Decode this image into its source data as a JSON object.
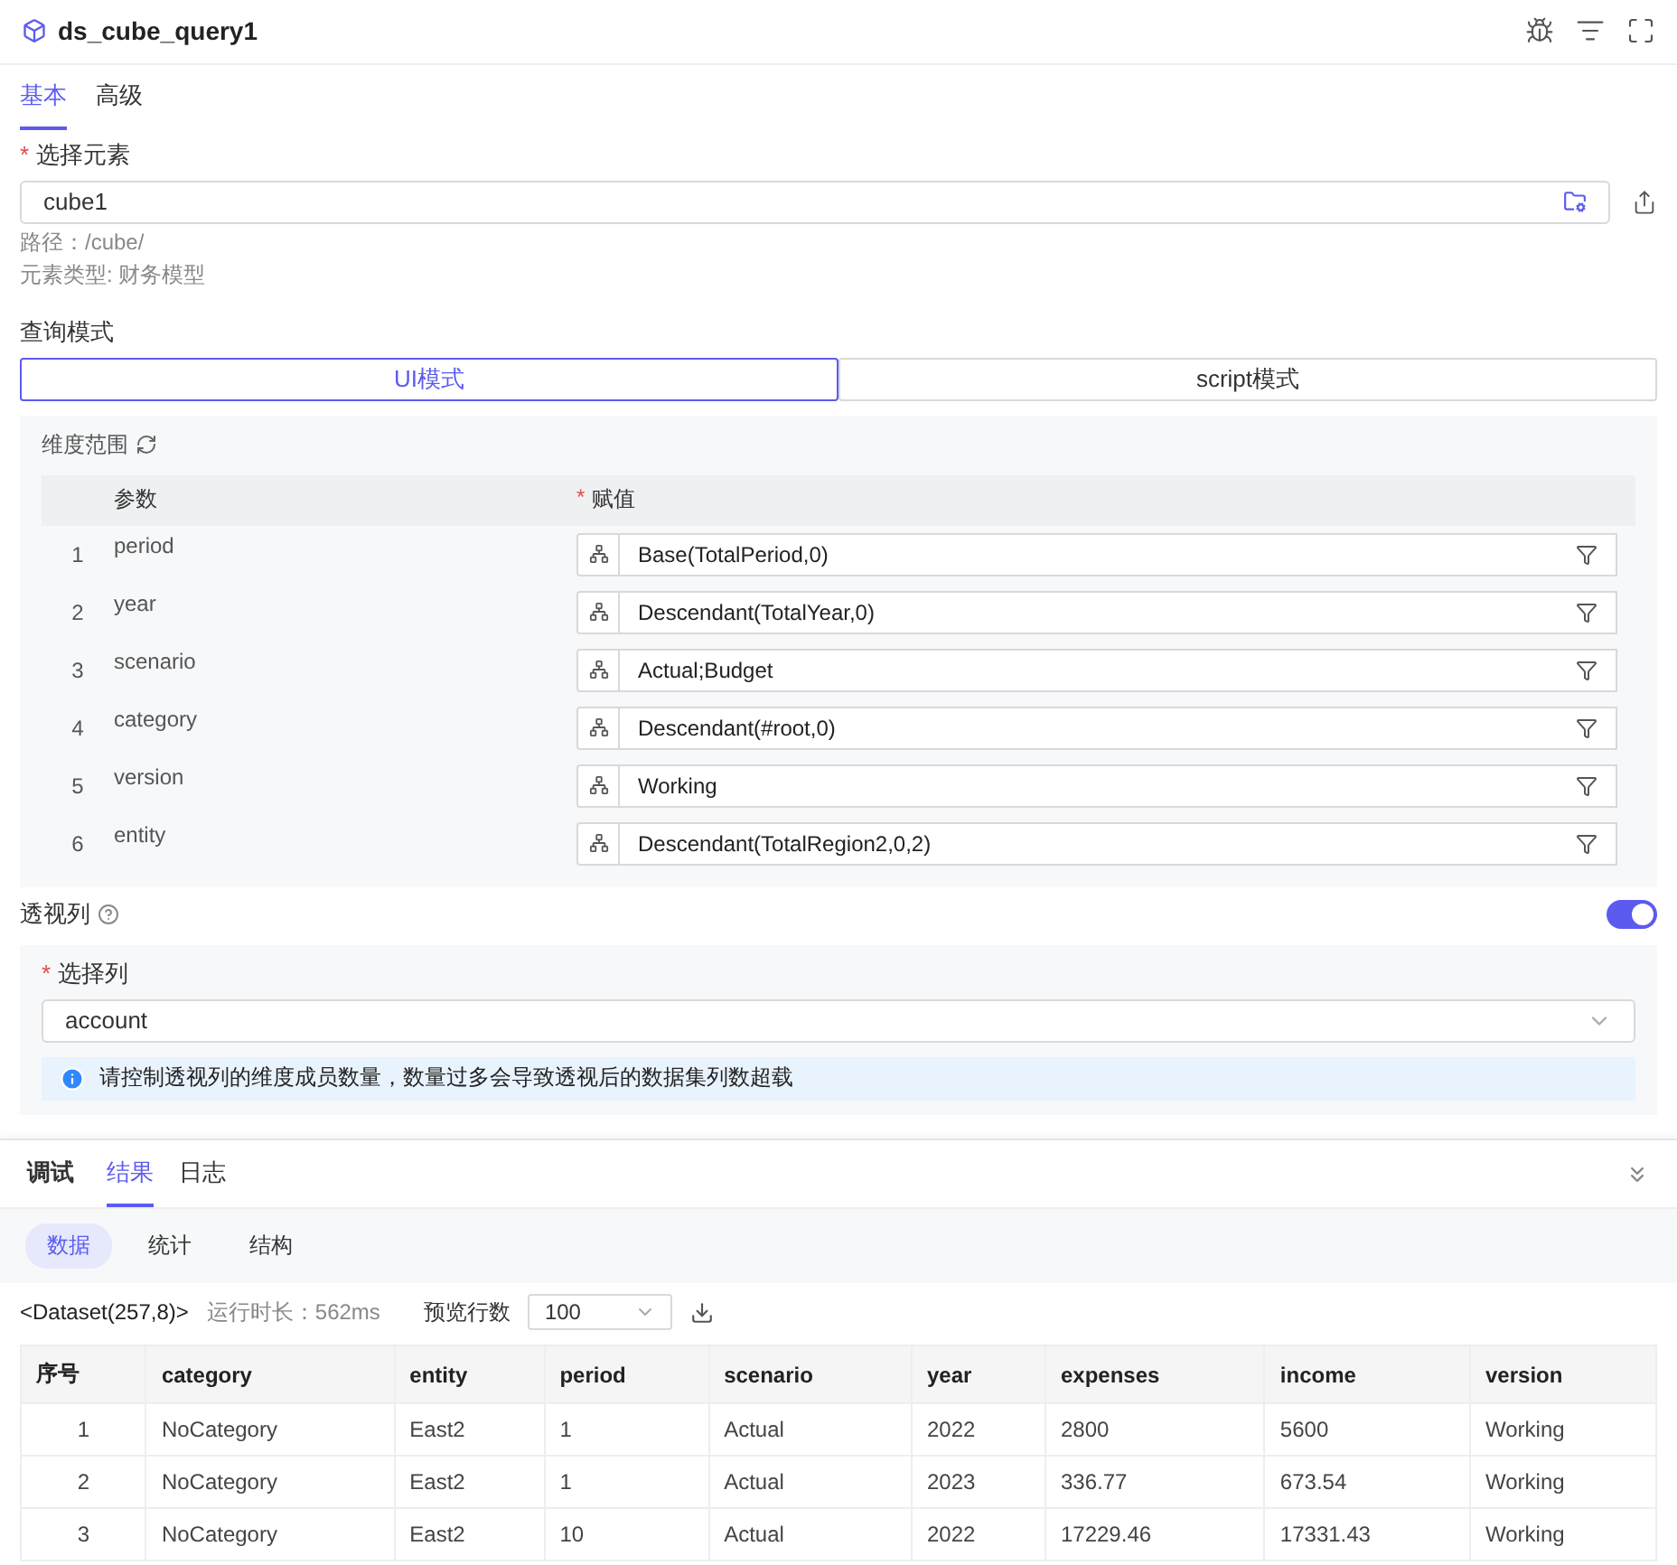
{
  "header": {
    "title": "ds_cube_query1"
  },
  "tabs": [
    {
      "label": "基本",
      "selected": true
    },
    {
      "label": "高级",
      "selected": false
    }
  ],
  "element": {
    "label": "选择元素",
    "required_mark": "*",
    "value": "cube1",
    "path": "路径：/cube/",
    "type": "元素类型: 财务模型"
  },
  "query_mode": {
    "label": "查询模式",
    "options": [
      {
        "label": "UI模式",
        "selected": true
      },
      {
        "label": "script模式",
        "selected": false
      }
    ]
  },
  "dimension": {
    "title": "维度范围",
    "columns": [
      "参数",
      "赋值"
    ],
    "value_mark": "*",
    "rows": [
      {
        "index": "1",
        "name": "period",
        "value": "Base(TotalPeriod,0)"
      },
      {
        "index": "2",
        "name": "year",
        "value": "Descendant(TotalYear,0)"
      },
      {
        "index": "3",
        "name": "scenario",
        "value": "Actual;Budget"
      },
      {
        "index": "4",
        "name": "category",
        "value": "Descendant(#root,0)"
      },
      {
        "index": "5",
        "name": "version",
        "value": "Working"
      },
      {
        "index": "6",
        "name": "entity",
        "value": "Descendant(TotalRegion2,0,2)"
      }
    ]
  },
  "pivot": {
    "label": "透视列",
    "on": true,
    "column_mark": "*",
    "column_label": "选择列",
    "column_value": "account",
    "notice": "请控制透视列的维度成员数量，数量过多会导致透视后的数据集列数超载"
  },
  "bottom_tabs": [
    {
      "label": "调试",
      "selected": false
    },
    {
      "label": "结果",
      "selected": true
    },
    {
      "label": "日志",
      "selected": false
    }
  ],
  "sub_tabs": [
    {
      "label": "数据",
      "selected": true
    },
    {
      "label": "统计",
      "selected": false
    },
    {
      "label": "结构",
      "selected": false
    }
  ],
  "info": {
    "dataset": "<Dataset(257,8)>",
    "runtime": "运行时长：562ms",
    "preview_label": "预览行数",
    "preview_value": "100"
  },
  "table": {
    "columns": [
      "序号",
      "category",
      "entity",
      "period",
      "scenario",
      "year",
      "expenses",
      "income",
      "version"
    ],
    "rows": [
      [
        "1",
        "NoCategory",
        "East2",
        "1",
        "Actual",
        "2022",
        "2800",
        "5600",
        "Working"
      ],
      [
        "2",
        "NoCategory",
        "East2",
        "1",
        "Actual",
        "2023",
        "336.77",
        "673.54",
        "Working"
      ],
      [
        "3",
        "NoCategory",
        "East2",
        "10",
        "Actual",
        "2022",
        "17229.46",
        "17331.43",
        "Working"
      ]
    ]
  }
}
